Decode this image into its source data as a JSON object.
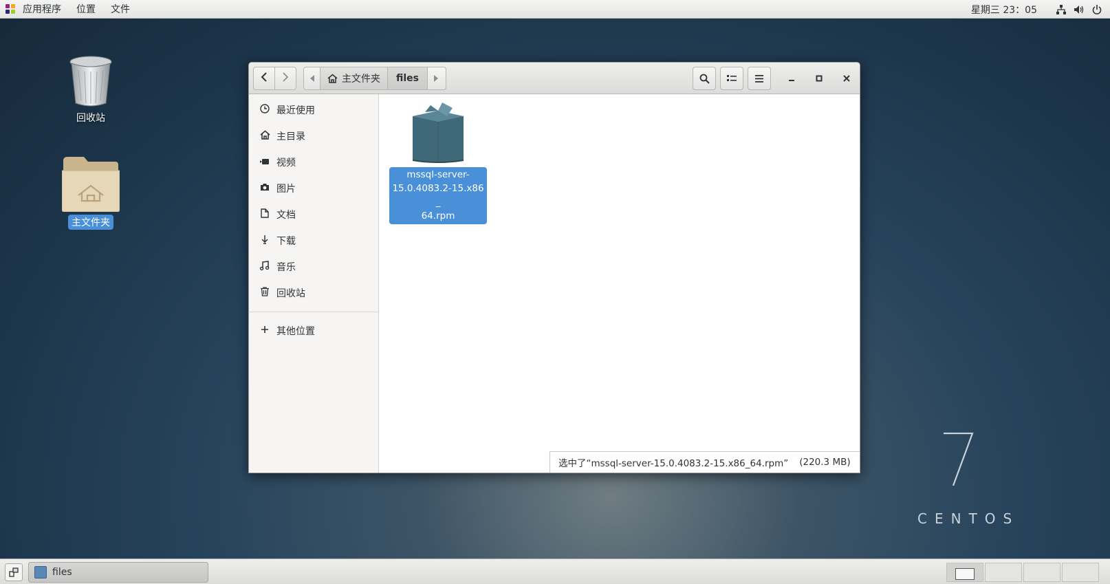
{
  "topbar": {
    "menus": [
      "应用程序",
      "位置",
      "文件"
    ],
    "clock": "星期三 23：05",
    "tray_icons": [
      "network-icon",
      "volume-icon",
      "power-icon"
    ]
  },
  "desktop": {
    "icons": [
      {
        "label": "回收站",
        "icon": "trash-icon",
        "selected": false
      },
      {
        "label": "主文件夹",
        "icon": "home-folder-icon",
        "selected": true
      }
    ]
  },
  "window": {
    "pathbar": {
      "home_label": "主文件夹",
      "current": "files"
    },
    "sidebar": {
      "items": [
        {
          "label": "最近使用",
          "icon": "clock-icon"
        },
        {
          "label": "主目录",
          "icon": "home-icon"
        },
        {
          "label": "视频",
          "icon": "video-icon"
        },
        {
          "label": "图片",
          "icon": "camera-icon"
        },
        {
          "label": "文档",
          "icon": "document-icon"
        },
        {
          "label": "下载",
          "icon": "download-icon"
        },
        {
          "label": "音乐",
          "icon": "music-icon"
        },
        {
          "label": "回收站",
          "icon": "trash-icon"
        }
      ],
      "other": {
        "label": "其他位置",
        "icon": "plus-icon"
      }
    },
    "files": [
      {
        "name": "mssql-server-15.0.4083.2-15.x86_64.rpm",
        "name_lines": [
          "mssql-server-",
          "15.0.4083.2-15.x86_",
          "64.rpm"
        ],
        "icon": "package-icon",
        "selected": true
      }
    ],
    "status": {
      "text": "选中了“mssql-server-15.0.4083.2-15.x86_64.rpm”",
      "size": "(220.3 MB)"
    }
  },
  "watermark": {
    "number": "7",
    "text": "CENTOS"
  },
  "bottombar": {
    "task_label": "files",
    "workspaces": 4,
    "active_workspace": 1
  },
  "colors": {
    "selection": "#4a90d9",
    "package": "#3f6878"
  }
}
